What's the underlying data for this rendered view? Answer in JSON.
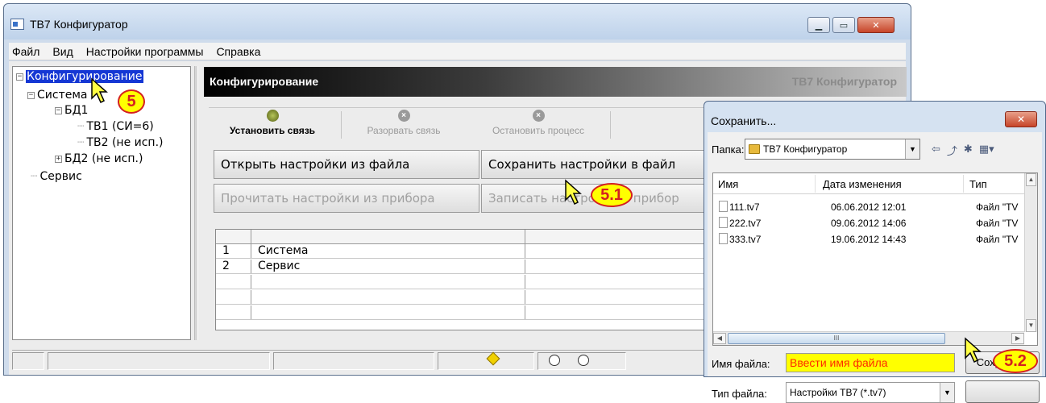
{
  "main_window": {
    "title": "ТВ7 Конфигуратор",
    "menu": [
      "Файл",
      "Вид",
      "Настройки программы",
      "Справка"
    ],
    "tree": {
      "root": "Конфигурирование",
      "system": "Система",
      "bd1": "БД1",
      "tv1": "ТВ1 (СИ=6)",
      "tv2": "ТВ2 (не исп.)",
      "bd2": "БД2 (не исп.)",
      "service": "Сервис"
    },
    "header": {
      "title": "Конфигурирование",
      "app_name": "ТВ7 Конфигуратор"
    },
    "toolbar": {
      "connect": "Установить связь",
      "disconnect": "Разорвать связь",
      "stop": "Остановить процесс"
    },
    "buttons": {
      "open_file": "Открыть настройки из файла",
      "save_file": "Сохранить настройки в файл",
      "read_device": "Прочитать настройки из прибора",
      "write_device": "Записать настройки в прибор"
    },
    "grid_rows": [
      {
        "num": "1",
        "name": "Система"
      },
      {
        "num": "2",
        "name": "Сервис"
      }
    ]
  },
  "save_dialog": {
    "title": "Сохранить...",
    "folder_label": "Папка:",
    "folder_value": "ТВ7 Конфигуратор",
    "columns": [
      "Имя",
      "Дата изменения",
      "Тип"
    ],
    "files": [
      {
        "name": "111.tv7",
        "date": "06.06.2012 12:01",
        "type": "Файл \"TV"
      },
      {
        "name": "222.tv7",
        "date": "09.06.2012 14:06",
        "type": "Файл \"TV"
      },
      {
        "name": "333.tv7",
        "date": "19.06.2012 14:43",
        "type": "Файл \"TV"
      }
    ],
    "filename_label": "Имя файла:",
    "filename_value": "Ввести имя файла",
    "save_button": "Сохранить",
    "filetype_label": "Тип файла:",
    "filetype_value": "Настройки ТВ7 (*.tv7)",
    "scroll_thumb_glyph": "III"
  },
  "callouts": {
    "step1": "5",
    "step2": "5.1",
    "step3": "5.2"
  },
  "colors": {
    "selection": "#1537d4",
    "callout_fill": "#ffff00",
    "callout_border": "#d42020",
    "filename_text": "#ff2a00"
  }
}
